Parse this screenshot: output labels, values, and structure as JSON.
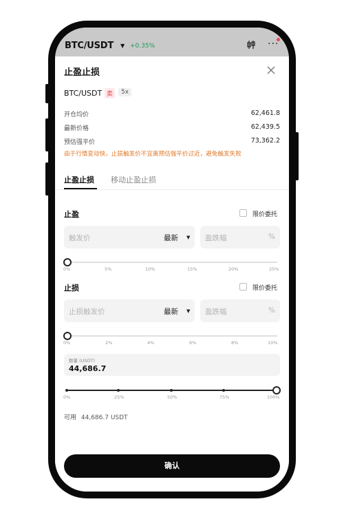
{
  "header": {
    "pair": "BTC/USDT",
    "change": "+0.35%",
    "chart_icon": "candlestick-icon",
    "more_icon": "more-dots-icon"
  },
  "sheet": {
    "title": "止盈止损",
    "close_icon": "close-icon",
    "pair": "BTC/USDT",
    "side": "卖",
    "leverage": "5x",
    "info": [
      {
        "label": "开仓均价",
        "value": "62,461.8"
      },
      {
        "label": "最新价格",
        "value": "62,439.5"
      },
      {
        "label": "预估强平价",
        "value": "73,362.2"
      }
    ],
    "warning": "由于行情变动快，止损触发价不宜离预估强平价过近，避免触发失败"
  },
  "tabs": [
    {
      "label": "止盈止损",
      "active": true
    },
    {
      "label": "移动止盈止损",
      "active": false
    }
  ],
  "take_profit": {
    "title": "止盈",
    "limit_label": "限价委托",
    "trigger_placeholder": "触发价",
    "price_type": "最新",
    "pct_placeholder": "盈跌幅",
    "pct_unit": "%",
    "slider_value_percent": 0,
    "slider_labels": [
      "0%",
      "5%",
      "10%",
      "15%",
      "20%",
      "25%"
    ]
  },
  "stop_loss": {
    "title": "止损",
    "limit_label": "限价委托",
    "trigger_placeholder": "止损触发价",
    "price_type": "最新",
    "pct_placeholder": "盈跌幅",
    "pct_unit": "%",
    "slider_value_percent": 0,
    "slider_labels": [
      "0%",
      "2%",
      "4%",
      "6%",
      "8%",
      "10%"
    ]
  },
  "quantity": {
    "label": "数量 (USDT)",
    "value": "44,686.7",
    "slider_value_percent": 100,
    "slider_labels": [
      "0%",
      "25%",
      "50%",
      "75%",
      "100%"
    ]
  },
  "available": {
    "label": "可用",
    "value": "44,686.7 USDT"
  },
  "confirm_label": "确认",
  "colors": {
    "sell": "#e5484d",
    "positive": "#1e9a5a",
    "warning": "#e07a2a",
    "button": "#0b0b0b"
  }
}
